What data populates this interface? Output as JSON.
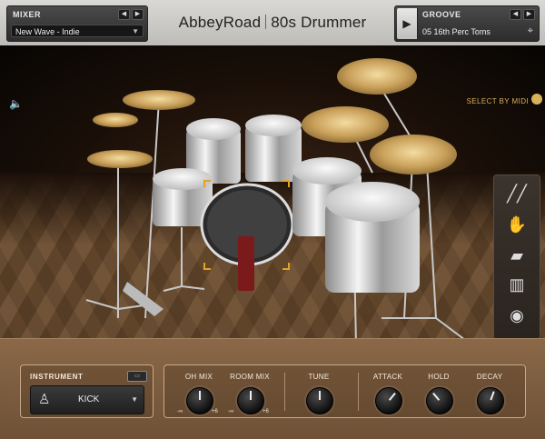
{
  "app": {
    "title_left": "AbbeyRoad",
    "title_right": "80s Drummer"
  },
  "mixer": {
    "label": "MIXER",
    "preset": "New Wave - Indie",
    "prev": "◀",
    "next": "▶"
  },
  "groove": {
    "label": "GROOVE",
    "value": "05 16th Perc Toms",
    "play": "▶",
    "prev": "◀",
    "next": "▶"
  },
  "stage": {
    "select_by_midi": "SELECT BY MIDI"
  },
  "instrument": {
    "label": "INSTRUMENT",
    "selected": "KICK"
  },
  "controls": {
    "oh_mix": {
      "label": "OH MIX",
      "min": "-∞",
      "max": "+6"
    },
    "room_mix": {
      "label": "ROOM MIX",
      "min": "-∞",
      "max": "+6"
    },
    "tune": {
      "label": "TUNE"
    },
    "attack": {
      "label": "ATTACK"
    },
    "hold": {
      "label": "HOLD"
    },
    "decay": {
      "label": "DECAY"
    }
  },
  "icons": {
    "speaker": "speaker-icon",
    "palette": "palette-icon",
    "sticks": "drumsticks-icon",
    "hands": "hands-icon",
    "cowbell": "cowbell-icon",
    "shaker": "shaker-icon",
    "cymbal_tool": "cymbal-tool-icon"
  },
  "colors": {
    "accent": "#d8b25a",
    "bottom_panel": "#7a5b3f",
    "topbar": "#cfcecb"
  }
}
